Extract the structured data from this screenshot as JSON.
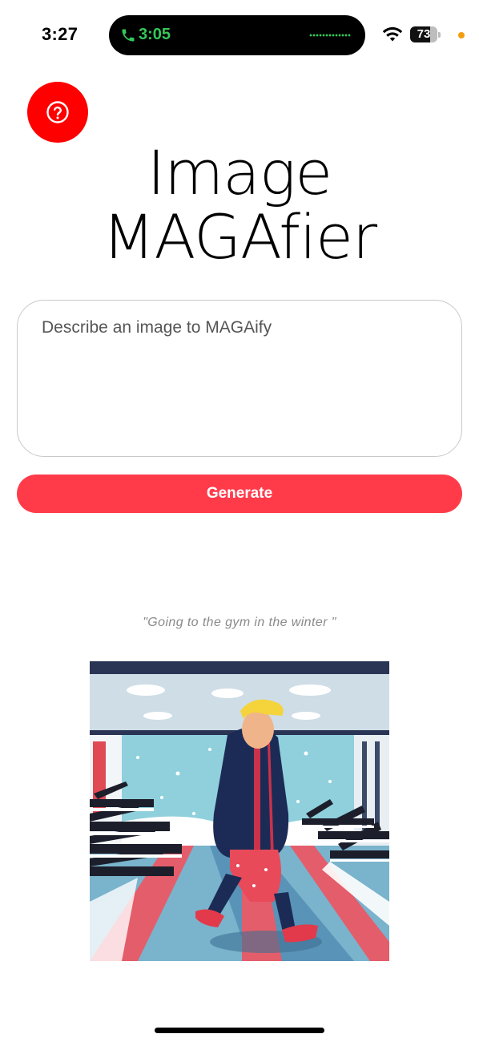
{
  "status_bar": {
    "time": "3:27",
    "call_time": "3:05",
    "battery": "73",
    "battery_level": 0.73
  },
  "help": {
    "icon": "question-circle-icon",
    "color": "#ff0000"
  },
  "title": {
    "line1": "Image",
    "line2": "MAGAfier"
  },
  "prompt": {
    "placeholder": "Describe an image to MAGAify",
    "value": ""
  },
  "generate": {
    "label": "Generate",
    "color": "#ff3b4a"
  },
  "result": {
    "caption": "\"Going to the gym in the winter \""
  }
}
